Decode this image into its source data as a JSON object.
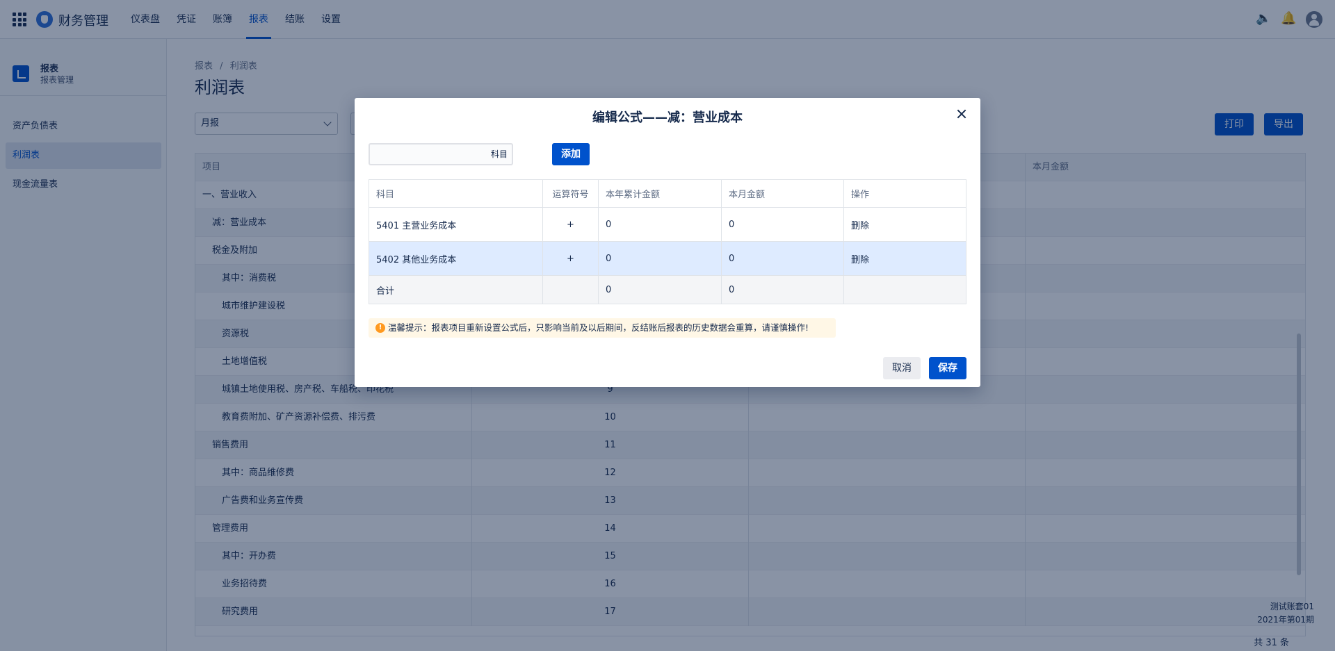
{
  "app": {
    "title": "财务管理",
    "accent": "#0052cc"
  },
  "nav": {
    "items": [
      {
        "label": "仪表盘"
      },
      {
        "label": "凭证"
      },
      {
        "label": "账簿"
      },
      {
        "label": "报表",
        "active": true
      },
      {
        "label": "结账"
      },
      {
        "label": "设置"
      }
    ]
  },
  "header_icons": [
    "speaker-icon",
    "bell-icon",
    "user-avatar-icon"
  ],
  "sidebar": {
    "title": "报表",
    "subtitle": "报表管理",
    "items": [
      {
        "label": "资产负债表"
      },
      {
        "label": "利润表",
        "active": true
      },
      {
        "label": "现金流量表"
      }
    ]
  },
  "breadcrumb": [
    "报表",
    "/",
    "利润表"
  ],
  "page": {
    "title": "利润表"
  },
  "filters": {
    "period_value": "月报"
  },
  "toolbar": {
    "print_label": "打印",
    "export_label": "导出"
  },
  "report": {
    "columns": [
      "项目",
      "",
      "",
      "本月金额"
    ],
    "rows": [
      {
        "name": "一、营业收入",
        "line": "",
        "indent": 0
      },
      {
        "name": "减：营业成本",
        "line": "",
        "indent": 1
      },
      {
        "name": "税金及附加",
        "line": "",
        "indent": 1
      },
      {
        "name": "其中：消费税",
        "line": "",
        "indent": 2
      },
      {
        "name": "城市维护建设税",
        "line": "",
        "indent": 2
      },
      {
        "name": "资源税",
        "line": "",
        "indent": 2
      },
      {
        "name": "土地增值税",
        "line": "",
        "indent": 2
      },
      {
        "name": "城镇土地使用税、房产税、车船税、印花税",
        "line": "9",
        "indent": 2
      },
      {
        "name": "教育费附加、矿产资源补偿费、排污费",
        "line": "10",
        "indent": 2
      },
      {
        "name": "销售费用",
        "line": "11",
        "indent": 1
      },
      {
        "name": "其中：商品维修费",
        "line": "12",
        "indent": 2
      },
      {
        "name": "广告费和业务宣传费",
        "line": "13",
        "indent": 2
      },
      {
        "name": "管理费用",
        "line": "14",
        "indent": 1
      },
      {
        "name": "其中：开办费",
        "line": "15",
        "indent": 2
      },
      {
        "name": "业务招待费",
        "line": "16",
        "indent": 2
      },
      {
        "name": "研究费用",
        "line": "17",
        "indent": 2
      }
    ]
  },
  "footer": {
    "account": "测试账套01",
    "period": "2021年第01期",
    "total": "共 31 条"
  },
  "modal": {
    "title": "编辑公式——减：营业成本",
    "subject_input_value": "科目",
    "add_label": "添加",
    "columns": [
      "科目",
      "运算符号",
      "本年累计金额",
      "本月金额",
      "操作"
    ],
    "rows": [
      {
        "subject": "5401 主营业务成本",
        "op": "+",
        "year_total": "0",
        "month_amount": "0",
        "action": "删除"
      },
      {
        "subject": "5402 其他业务成本",
        "op": "+",
        "year_total": "0",
        "month_amount": "0",
        "action": "删除"
      }
    ],
    "total_row": {
      "label": "合计",
      "op": "",
      "year_total": "0",
      "month_amount": "0",
      "action": ""
    },
    "tip": "温馨提示：报表项目重新设置公式后，只影响当前及以后期间，反结账后报表的历史数据会重算，请谨慎操作!",
    "cancel_label": "取消",
    "save_label": "保存"
  }
}
